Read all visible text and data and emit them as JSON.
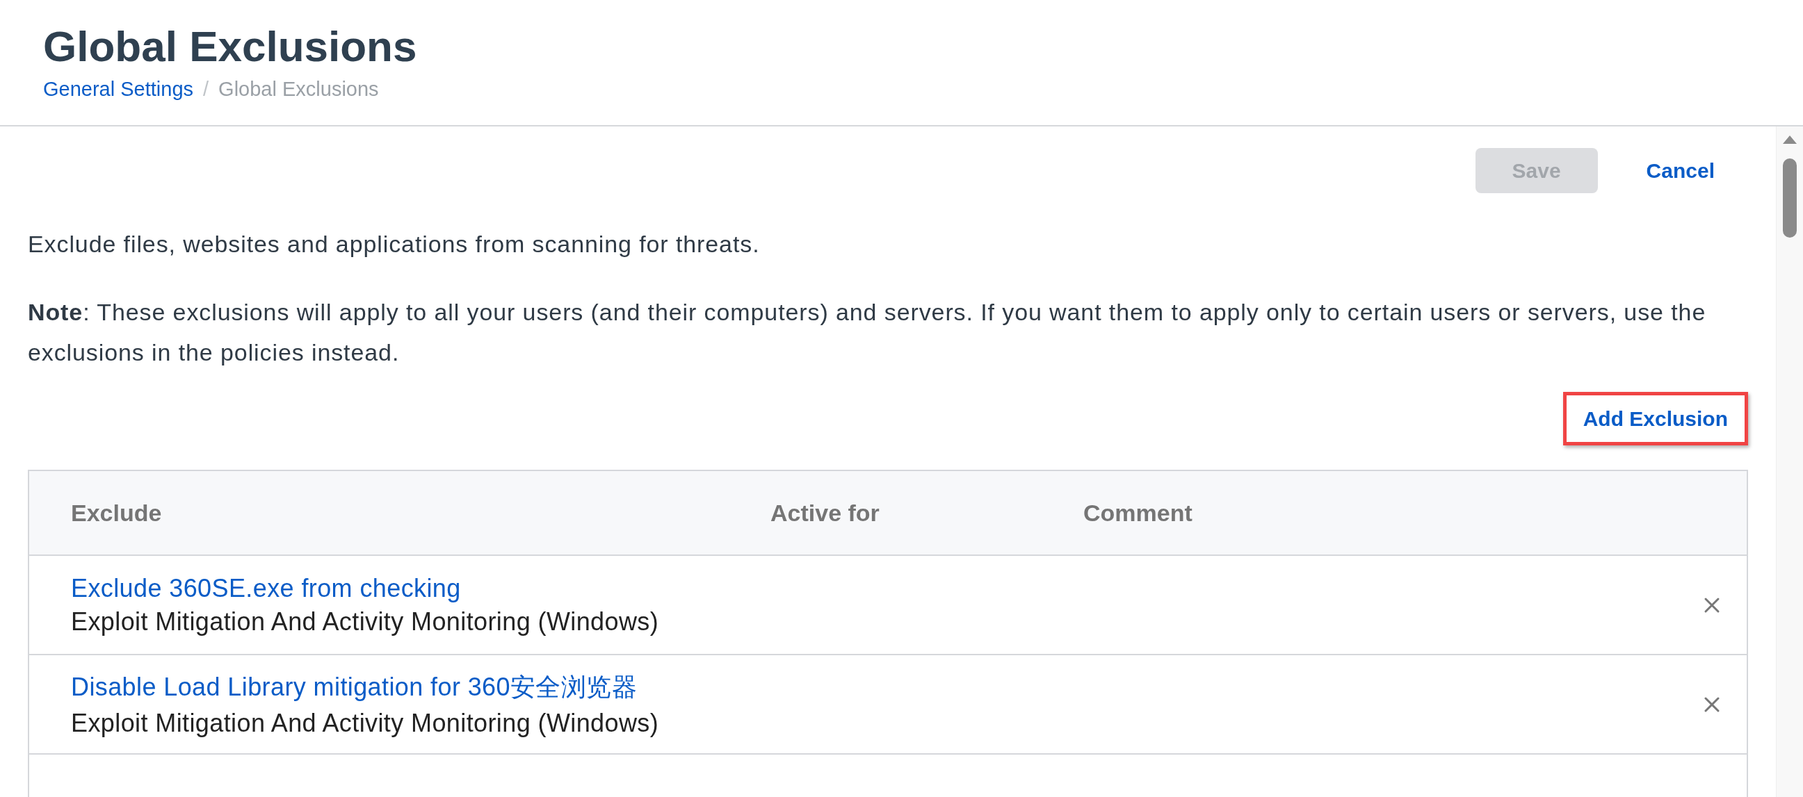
{
  "header": {
    "title": "Global Exclusions",
    "breadcrumb": [
      {
        "label": "General Settings",
        "kind": "link"
      },
      {
        "label": "/",
        "kind": "separator"
      },
      {
        "label": "Global Exclusions",
        "kind": "current"
      }
    ]
  },
  "actions": {
    "save": {
      "label": "Save",
      "disabled": true
    },
    "cancel": {
      "label": "Cancel"
    }
  },
  "description": "Exclude files, websites and applications from scanning for threats.",
  "note": "**Note**: These exclusions will apply to all your users (and their computers) and servers. If you want them to apply only to certain users or servers, use the exclusions in the policies instead.",
  "add_button": {
    "label": "Add Exclusion",
    "highlighted": true
  },
  "table": {
    "columns": [
      "Exclude",
      "Active for",
      "Comment"
    ],
    "rows": [
      {
        "title": "Exclude 360SE.exe from checking",
        "type": "Exploit Mitigation And Activity Monitoring (Windows)"
      },
      {
        "title": "Disable Load Library mitigation for 360安全浏览器",
        "type": "Exploit Mitigation And Activity Monitoring (Windows)"
      }
    ]
  }
}
